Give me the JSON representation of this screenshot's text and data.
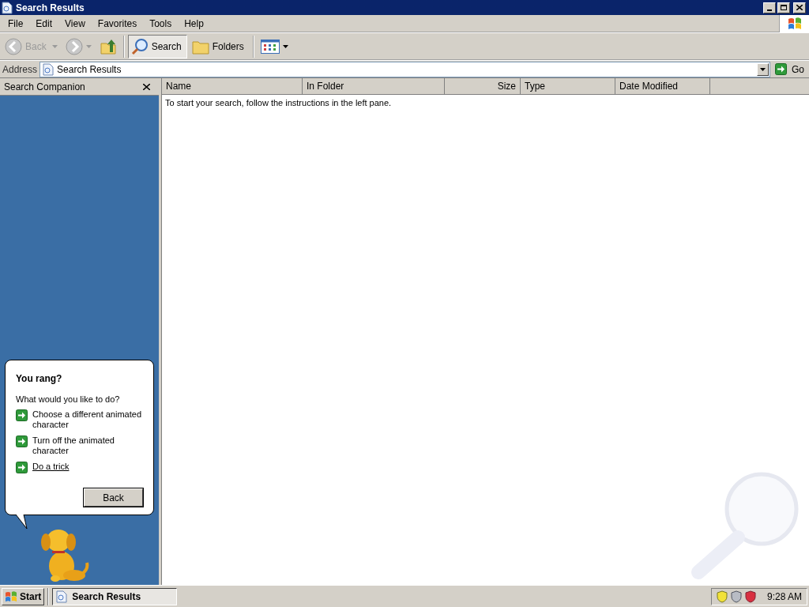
{
  "window": {
    "title": "Search Results"
  },
  "menu": [
    "File",
    "Edit",
    "View",
    "Favorites",
    "Tools",
    "Help"
  ],
  "toolbar": [
    {
      "kind": "back",
      "label": "Back",
      "disabled": true,
      "selected": false
    },
    {
      "kind": "forward",
      "disabled": true,
      "selected": false
    },
    {
      "kind": "up",
      "disabled": false,
      "selected": false
    },
    {
      "kind": "search",
      "label": "Search",
      "disabled": false,
      "selected": true
    },
    {
      "kind": "folders",
      "label": "Folders",
      "disabled": false,
      "selected": false
    },
    {
      "kind": "views",
      "disabled": false,
      "selected": false
    }
  ],
  "address": {
    "label": "Address",
    "value": "Search Results",
    "go": "Go"
  },
  "pane": {
    "title": "Search Companion"
  },
  "balloon": {
    "title": "You rang?",
    "prompt": "What would you like to do?",
    "options": [
      {
        "label": "Choose a different animated character",
        "hovered": false
      },
      {
        "label": "Turn off the animated character",
        "hovered": false
      },
      {
        "label": "Do a trick",
        "hovered": true
      }
    ],
    "button": "Back"
  },
  "columns": [
    {
      "label": "Name",
      "right_aligned": false
    },
    {
      "label": "In Folder",
      "right_aligned": false
    },
    {
      "label": "Size",
      "right_aligned": true
    },
    {
      "label": "Type",
      "right_aligned": false
    },
    {
      "label": "Date Modified",
      "right_aligned": false
    }
  ],
  "message": "To start your search, follow the instructions in the left pane.",
  "taskbar": {
    "start": "Start",
    "tasks": [
      {
        "label": "Search Results",
        "selected": true
      }
    ],
    "clock": "9:28 AM"
  }
}
